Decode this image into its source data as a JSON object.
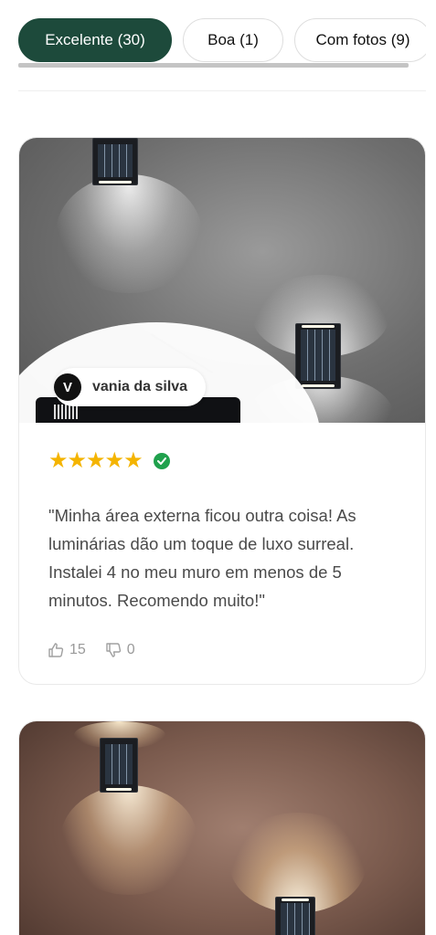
{
  "filters": [
    {
      "label": "Excelente (30)",
      "active": true
    },
    {
      "label": "Boa (1)",
      "active": false
    },
    {
      "label": "Com fotos (9)",
      "active": false
    }
  ],
  "reviews": [
    {
      "author_initial": "V",
      "author_name": "vania da silva",
      "rating": 5,
      "stars": "★★★★★",
      "verified_icon": "check-circle-icon",
      "text": "\"Minha área externa ficou outra coisa! As luminárias dão um toque de luxo surreal. Instalei 4 no meu muro em menos de 5 minutos. Recomendo muito!\"",
      "likes": "15",
      "dislikes": "0"
    }
  ],
  "colors": {
    "active_chip": "#1d4a3b",
    "star": "#f4b400",
    "verified": "#20a14d"
  }
}
